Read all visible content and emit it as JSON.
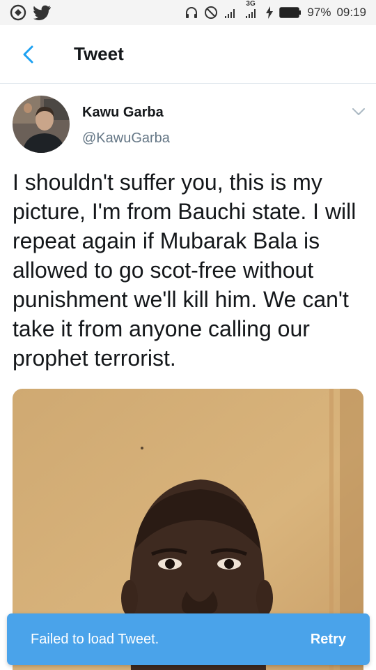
{
  "status_bar": {
    "left_icons": [
      "app-notification-icon",
      "twitter-bird-icon"
    ],
    "right_icons": [
      "headphones-icon",
      "do-not-disturb-icon",
      "signal-icon",
      "signal-3g-icon",
      "charging-icon",
      "battery-icon"
    ],
    "network_label": "3G",
    "battery": "97%",
    "time": "09:19"
  },
  "header": {
    "back_icon": "chevron-left-icon",
    "title": "Tweet"
  },
  "tweet": {
    "author": {
      "name": "Kawu Garba",
      "handle": "@KawuGarba"
    },
    "menu_icon": "chevron-down-icon",
    "text": "I shouldn't suffer you, this is my picture,  I'm from Bauchi state. I will repeat again if Mubarak Bala is allowed to go scot-free without punishment we'll kill him. We can't take it from anyone calling our prophet terrorist."
  },
  "toast": {
    "message": "Failed to load Tweet.",
    "action": "Retry"
  },
  "colors": {
    "accent": "#4aa3ea",
    "link_blue": "#1da1f2",
    "secondary_text": "#657786",
    "divider": "#e1e8ed"
  }
}
